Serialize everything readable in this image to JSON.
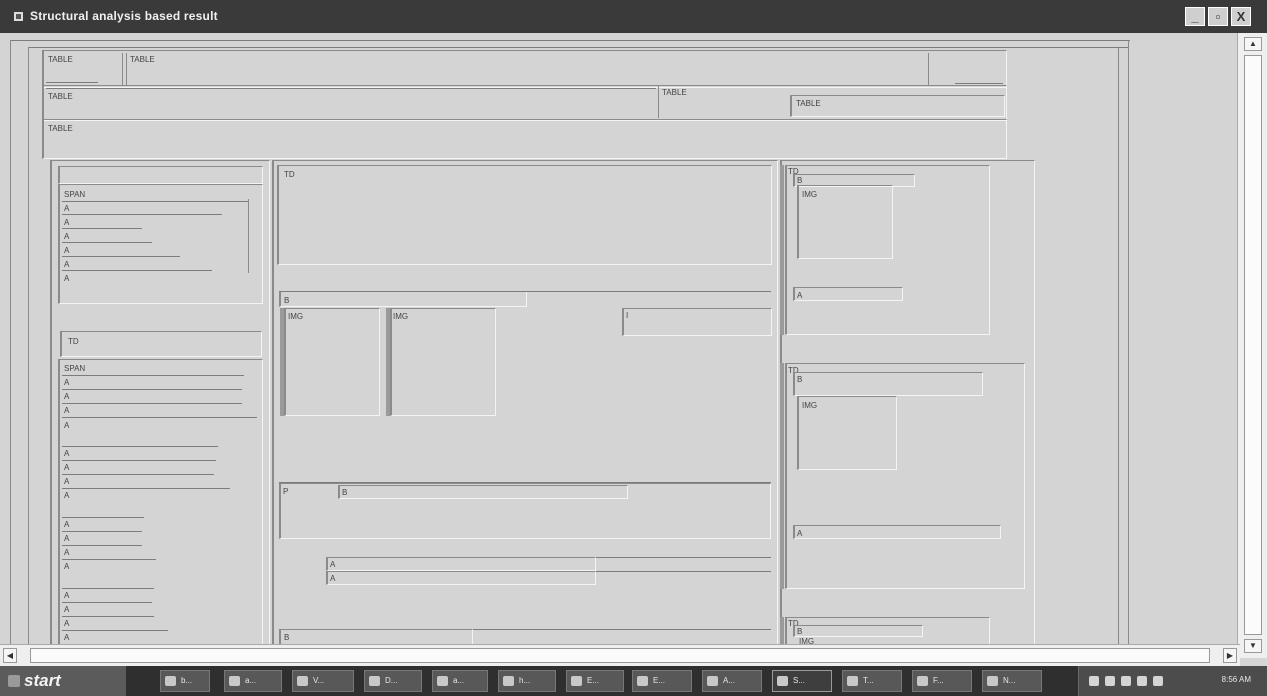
{
  "window": {
    "title": "Structural analysis based result",
    "minimize_glyph": "_",
    "maximize_glyph": "▫",
    "close_glyph": "X"
  },
  "scrollbars": {
    "up_glyph": "▲",
    "down_glyph": "▼",
    "left_glyph": "◀",
    "right_glyph": "▶"
  },
  "labels": {
    "table_top1": "TABLE",
    "table_top2": "TABLE",
    "table_row2_a": "TABLE",
    "table_row2_b": "TABLE",
    "table_row2_c": "TABLE",
    "table_row3": "TABLE",
    "left_span1": "SPAN",
    "left_td": "TD",
    "left_span2": "SPAN",
    "a": "A",
    "mid_td": "TD",
    "mid_b1": "B",
    "mid_img1": "IMG",
    "mid_img2": "IMG",
    "mid_i": "I",
    "mid_p": "P",
    "mid_b2": "B",
    "mid_a1": "A",
    "mid_a2": "A",
    "mid_b3": "B",
    "right_td1": "TD",
    "right_b1": "B",
    "right_img1": "IMG",
    "right_a1": "A",
    "right_td2": "TD",
    "right_b2": "B",
    "right_img2": "IMG",
    "right_a2": "A",
    "right_td3": "TD",
    "right_b3": "B",
    "right_img3": "IMG"
  },
  "taskbar": {
    "start_label": "start",
    "buttons": [
      "b...",
      "a...",
      "V...",
      "D...",
      "a...",
      "h...",
      "E...",
      "E...",
      "A...",
      "S...",
      "T...",
      "F...",
      "N..."
    ],
    "clock": "8:56 AM"
  },
  "icons": {
    "window_icon": "app-window-icon",
    "start_icon": "windows-flag-icon"
  }
}
